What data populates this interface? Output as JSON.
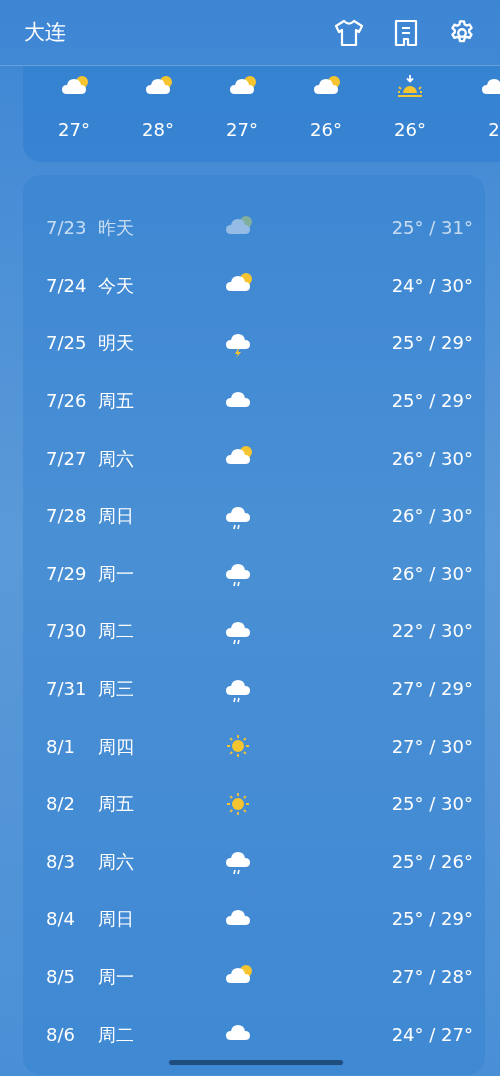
{
  "header": {
    "city": "大连"
  },
  "hourly": [
    {
      "kind": "partly_cloudy",
      "temp": "27°"
    },
    {
      "kind": "partly_cloudy",
      "temp": "28°"
    },
    {
      "kind": "partly_cloudy",
      "temp": "27°"
    },
    {
      "kind": "partly_cloudy",
      "temp": "26°"
    },
    {
      "kind": "sunset",
      "temp": "26°"
    },
    {
      "kind": "cloudy",
      "temp": "2"
    }
  ],
  "daily": [
    {
      "date": "7/23",
      "day": "昨天",
      "kind": "partly_cloudy",
      "temps": "25° / 31°",
      "past": true
    },
    {
      "date": "7/24",
      "day": "今天",
      "kind": "partly_cloudy",
      "temps": "24° / 30°",
      "past": false
    },
    {
      "date": "7/25",
      "day": "明天",
      "kind": "thunder",
      "temps": "25° / 29°",
      "past": false
    },
    {
      "date": "7/26",
      "day": "周五",
      "kind": "cloudy",
      "temps": "25° / 29°",
      "past": false
    },
    {
      "date": "7/27",
      "day": "周六",
      "kind": "partly_cloudy",
      "temps": "26° / 30°",
      "past": false
    },
    {
      "date": "7/28",
      "day": "周日",
      "kind": "rain",
      "temps": "26° / 30°",
      "past": false
    },
    {
      "date": "7/29",
      "day": "周一",
      "kind": "rain",
      "temps": "26° / 30°",
      "past": false
    },
    {
      "date": "7/30",
      "day": "周二",
      "kind": "rain",
      "temps": "22° / 30°",
      "past": false
    },
    {
      "date": "7/31",
      "day": "周三",
      "kind": "rain",
      "temps": "27° / 29°",
      "past": false
    },
    {
      "date": "8/1",
      "day": "周四",
      "kind": "sunny",
      "temps": "27° / 30°",
      "past": false
    },
    {
      "date": "8/2",
      "day": "周五",
      "kind": "sunny",
      "temps": "25° / 30°",
      "past": false
    },
    {
      "date": "8/3",
      "day": "周六",
      "kind": "rain",
      "temps": "25° / 26°",
      "past": false
    },
    {
      "date": "8/4",
      "day": "周日",
      "kind": "cloudy",
      "temps": "25° / 29°",
      "past": false
    },
    {
      "date": "8/5",
      "day": "周一",
      "kind": "partly_cloudy",
      "temps": "27° / 28°",
      "past": false
    },
    {
      "date": "8/6",
      "day": "周二",
      "kind": "cloudy",
      "temps": "24° / 27°",
      "past": false
    }
  ]
}
